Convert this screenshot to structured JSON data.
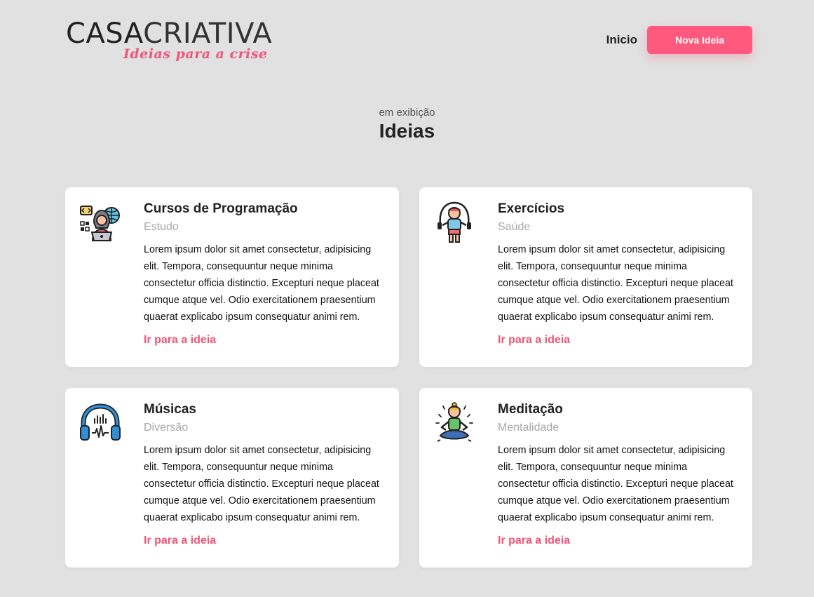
{
  "header": {
    "logo_main_bold": "CASA",
    "logo_main_light": "CRIATIVA",
    "logo_tagline": "Ideias para a crise",
    "nav_home": "Inicio",
    "nav_new_idea": "Nova Ideia"
  },
  "section": {
    "kicker": "em exibição",
    "heading": "Ideias"
  },
  "cards": [
    {
      "icon": "programmer-icon",
      "title": "Cursos de Programação",
      "category": "Estudo",
      "description": "Lorem ipsum dolor sit amet consectetur, adipisicing elit. Tempora, consequuntur neque minima consectetur officia distinctio. Excepturi neque placeat cumque atque vel. Odio exercitationem praesentium quaerat explicabo ipsum consequatur animi rem.",
      "link": "Ir para a ideia"
    },
    {
      "icon": "jump-rope-icon",
      "title": "Exercícios",
      "category": "Saúde",
      "description": "Lorem ipsum dolor sit amet consectetur, adipisicing elit. Tempora, consequuntur neque minima consectetur officia distinctio. Excepturi neque placeat cumque atque vel. Odio exercitationem praesentium quaerat explicabo ipsum consequatur animi rem.",
      "link": "Ir para a ideia"
    },
    {
      "icon": "headphones-icon",
      "title": "Músicas",
      "category": "Diversão",
      "description": "Lorem ipsum dolor sit amet consectetur, adipisicing elit. Tempora, consequuntur neque minima consectetur officia distinctio. Excepturi neque placeat cumque atque vel. Odio exercitationem praesentium quaerat explicabo ipsum consequatur animi rem.",
      "link": "Ir para a ideia"
    },
    {
      "icon": "meditation-icon",
      "title": "Meditação",
      "category": "Mentalidade",
      "description": "Lorem ipsum dolor sit amet consectetur, adipisicing elit. Tempora, consequuntur neque minima consectetur officia distinctio. Excepturi neque placeat cumque atque vel. Odio exercitationem praesentium quaerat explicabo ipsum consequatur animi rem.",
      "link": "Ir para a ideia"
    }
  ],
  "colors": {
    "background": "#e1e1e1",
    "accent": "#ff5a7d",
    "link": "#ef5577",
    "muted": "#a8a8a8"
  }
}
